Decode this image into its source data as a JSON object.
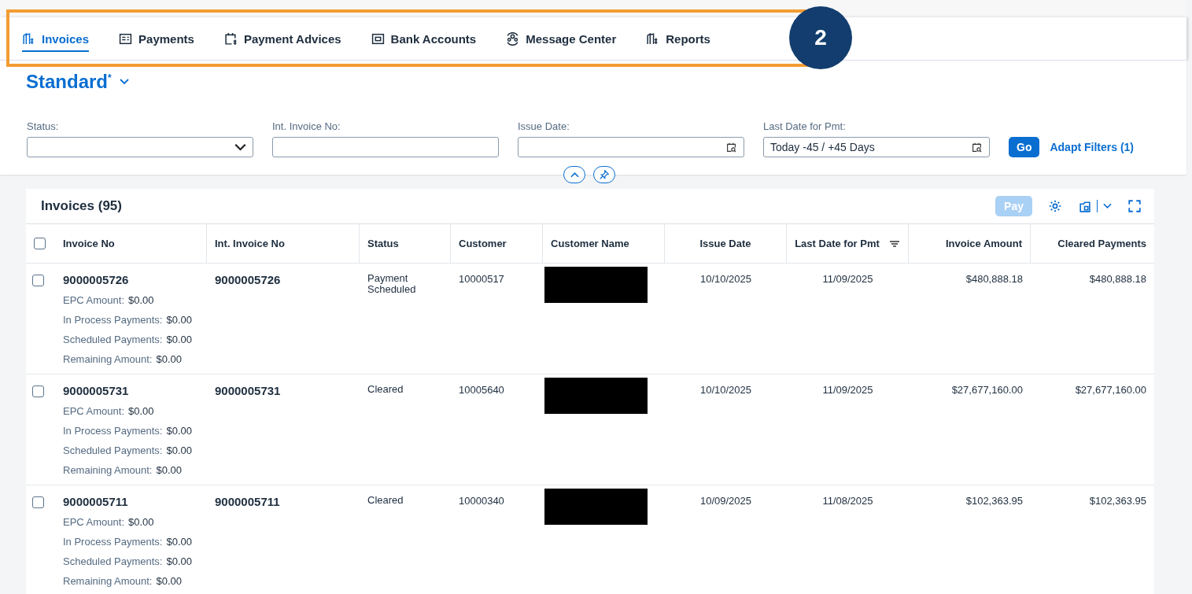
{
  "tabs": [
    {
      "label": "Invoices",
      "selected": true
    },
    {
      "label": "Payments",
      "selected": false
    },
    {
      "label": "Payment Advices",
      "selected": false
    },
    {
      "label": "Bank Accounts",
      "selected": false
    },
    {
      "label": "Message Center",
      "selected": false
    },
    {
      "label": "Reports",
      "selected": false
    }
  ],
  "callout": {
    "number": "2"
  },
  "variant": {
    "title": "Standard",
    "modified_mark": "*"
  },
  "filters": [
    {
      "label": "Status:",
      "kind": "select"
    },
    {
      "label": "Int. Invoice No:",
      "kind": "text"
    },
    {
      "label": "Issue Date:",
      "kind": "date"
    },
    {
      "label": "Last Date for Pmt:",
      "kind": "date",
      "value": "Today -45 / +45 Days"
    }
  ],
  "go_button": "Go",
  "adapt_filters": "Adapt Filters (1)",
  "table": {
    "title": "Invoices (95)",
    "select_all_checked": false,
    "pay_button": {
      "label": "Pay",
      "disabled": true
    },
    "columns": [
      "Invoice No",
      "Int. Invoice No",
      "Status",
      "Customer",
      "Customer Name",
      "Issue Date",
      "Last Date for Pmt",
      "Invoice Amount",
      "Cleared Payments"
    ],
    "rows": [
      {
        "selected": false,
        "invoice_no": "9000005726",
        "int_invoice_no": "9000005726",
        "status": "Payment Scheduled",
        "customer": "10000517",
        "customer_name_redacted": true,
        "issue_date": "10/10/2025",
        "last_date": "11/09/2025",
        "invoice_amount": "$480,888.18",
        "cleared": "$480,888.18",
        "details": [
          {
            "label": "EPC Amount:",
            "value": "$0.00"
          },
          {
            "label": "In Process Payments:",
            "value": "$0.00"
          },
          {
            "label": "Scheduled Payments:",
            "value": "$0.00"
          },
          {
            "label": "Remaining Amount:",
            "value": "$0.00"
          }
        ]
      },
      {
        "selected": false,
        "invoice_no": "9000005731",
        "int_invoice_no": "9000005731",
        "status": "Cleared",
        "customer": "10005640",
        "customer_name_redacted": true,
        "issue_date": "10/10/2025",
        "last_date": "11/09/2025",
        "invoice_amount": "$27,677,160.00",
        "cleared": "$27,677,160.00",
        "details": [
          {
            "label": "EPC Amount:",
            "value": "$0.00"
          },
          {
            "label": "In Process Payments:",
            "value": "$0.00"
          },
          {
            "label": "Scheduled Payments:",
            "value": "$0.00"
          },
          {
            "label": "Remaining Amount:",
            "value": "$0.00"
          }
        ]
      },
      {
        "selected": false,
        "invoice_no": "9000005711",
        "int_invoice_no": "9000005711",
        "status": "Cleared",
        "customer": "10000340",
        "customer_name_redacted": true,
        "issue_date": "10/09/2025",
        "last_date": "11/08/2025",
        "invoice_amount": "$102,363.95",
        "cleared": "$102,363.95",
        "details": [
          {
            "label": "EPC Amount:",
            "value": "$0.00"
          },
          {
            "label": "In Process Payments:",
            "value": "$0.00"
          },
          {
            "label": "Scheduled Payments:",
            "value": "$0.00"
          },
          {
            "label": "Remaining Amount:",
            "value": "$0.00"
          }
        ]
      }
    ]
  }
}
